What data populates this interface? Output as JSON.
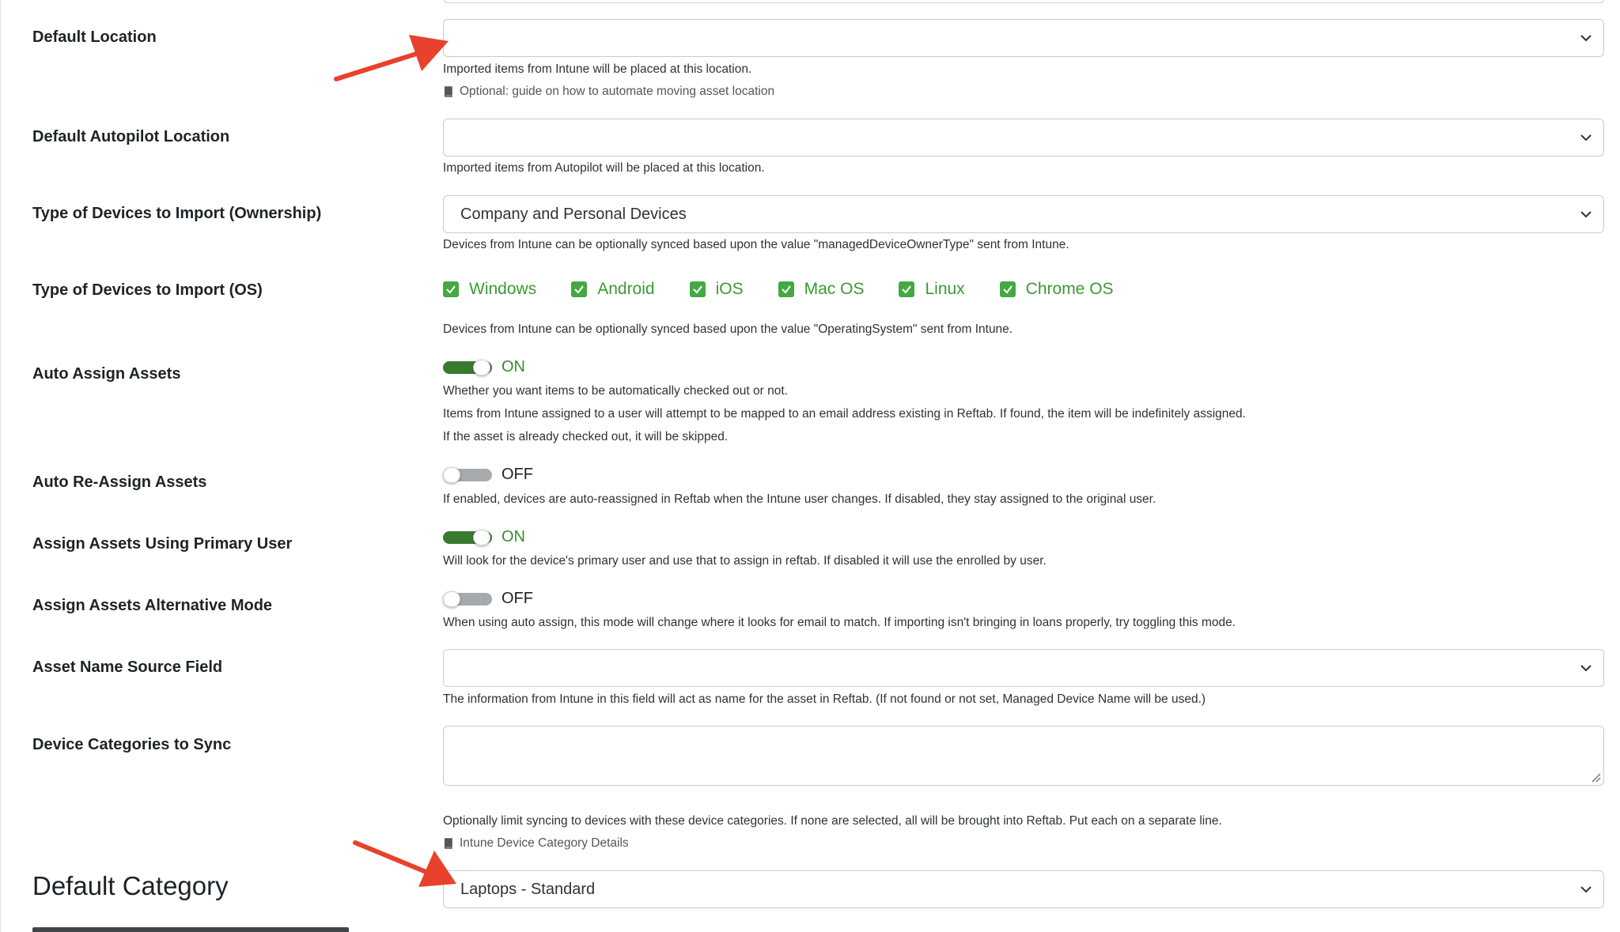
{
  "fields": {
    "default_location": {
      "label": "Default Location",
      "value": "",
      "help": "Imported items from Intune will be placed at this location.",
      "link": "Optional: guide on how to automate moving asset location"
    },
    "default_autopilot_location": {
      "label": "Default Autopilot Location",
      "value": "",
      "help": "Imported items from Autopilot will be placed at this location."
    },
    "ownership": {
      "label": "Type of Devices to Import (Ownership)",
      "value": "Company and Personal Devices",
      "help": "Devices from Intune can be optionally synced based upon the value \"managedDeviceOwnerType\" sent from Intune."
    },
    "os": {
      "label": "Type of Devices to Import (OS)",
      "options": [
        {
          "label": "Windows",
          "checked": true
        },
        {
          "label": "Android",
          "checked": true
        },
        {
          "label": "iOS",
          "checked": true
        },
        {
          "label": "Mac OS",
          "checked": true
        },
        {
          "label": "Linux",
          "checked": true
        },
        {
          "label": "Chrome OS",
          "checked": true
        }
      ],
      "help": "Devices from Intune can be optionally synced based upon the value \"OperatingSystem\" sent from Intune."
    },
    "auto_assign": {
      "label": "Auto Assign Assets",
      "state": "ON",
      "help1": "Whether you want items to be automatically checked out or not.",
      "help2": "Items from Intune assigned to a user will attempt to be mapped to an email address existing in Reftab. If found, the item will be indefinitely assigned.",
      "help3": "If the asset is already checked out, it will be skipped."
    },
    "auto_reassign": {
      "label": "Auto Re-Assign Assets",
      "state": "OFF",
      "help": "If enabled, devices are auto-reassigned in Reftab when the Intune user changes. If disabled, they stay assigned to the original user."
    },
    "primary_user": {
      "label": "Assign Assets Using Primary User",
      "state": "ON",
      "help": "Will look for the device's primary user and use that to assign in reftab. If disabled it will use the enrolled by user."
    },
    "alternative_mode": {
      "label": "Assign Assets Alternative Mode",
      "state": "OFF",
      "help": "When using auto assign, this mode will change where it looks for email to match. If importing isn't bringing in loans properly, try toggling this mode."
    },
    "asset_name_source": {
      "label": "Asset Name Source Field",
      "value": "",
      "help": "The information from Intune in this field will act as name for the asset in Reftab. (If not found or not set, Managed Device Name will be used.)"
    },
    "device_categories": {
      "label": "Device Categories to Sync",
      "value": "",
      "help": "Optionally limit syncing to devices with these device categories. If none are selected, all will be brought into Reftab. Put each on a separate line.",
      "link": "Intune Device Category Details"
    },
    "default_category": {
      "label": "Default Category",
      "value": "Laptops - Standard"
    }
  },
  "colors": {
    "annotation_arrow": "#e8412c",
    "toggle_on": "#3a7a2f",
    "checkbox": "#45a843"
  }
}
